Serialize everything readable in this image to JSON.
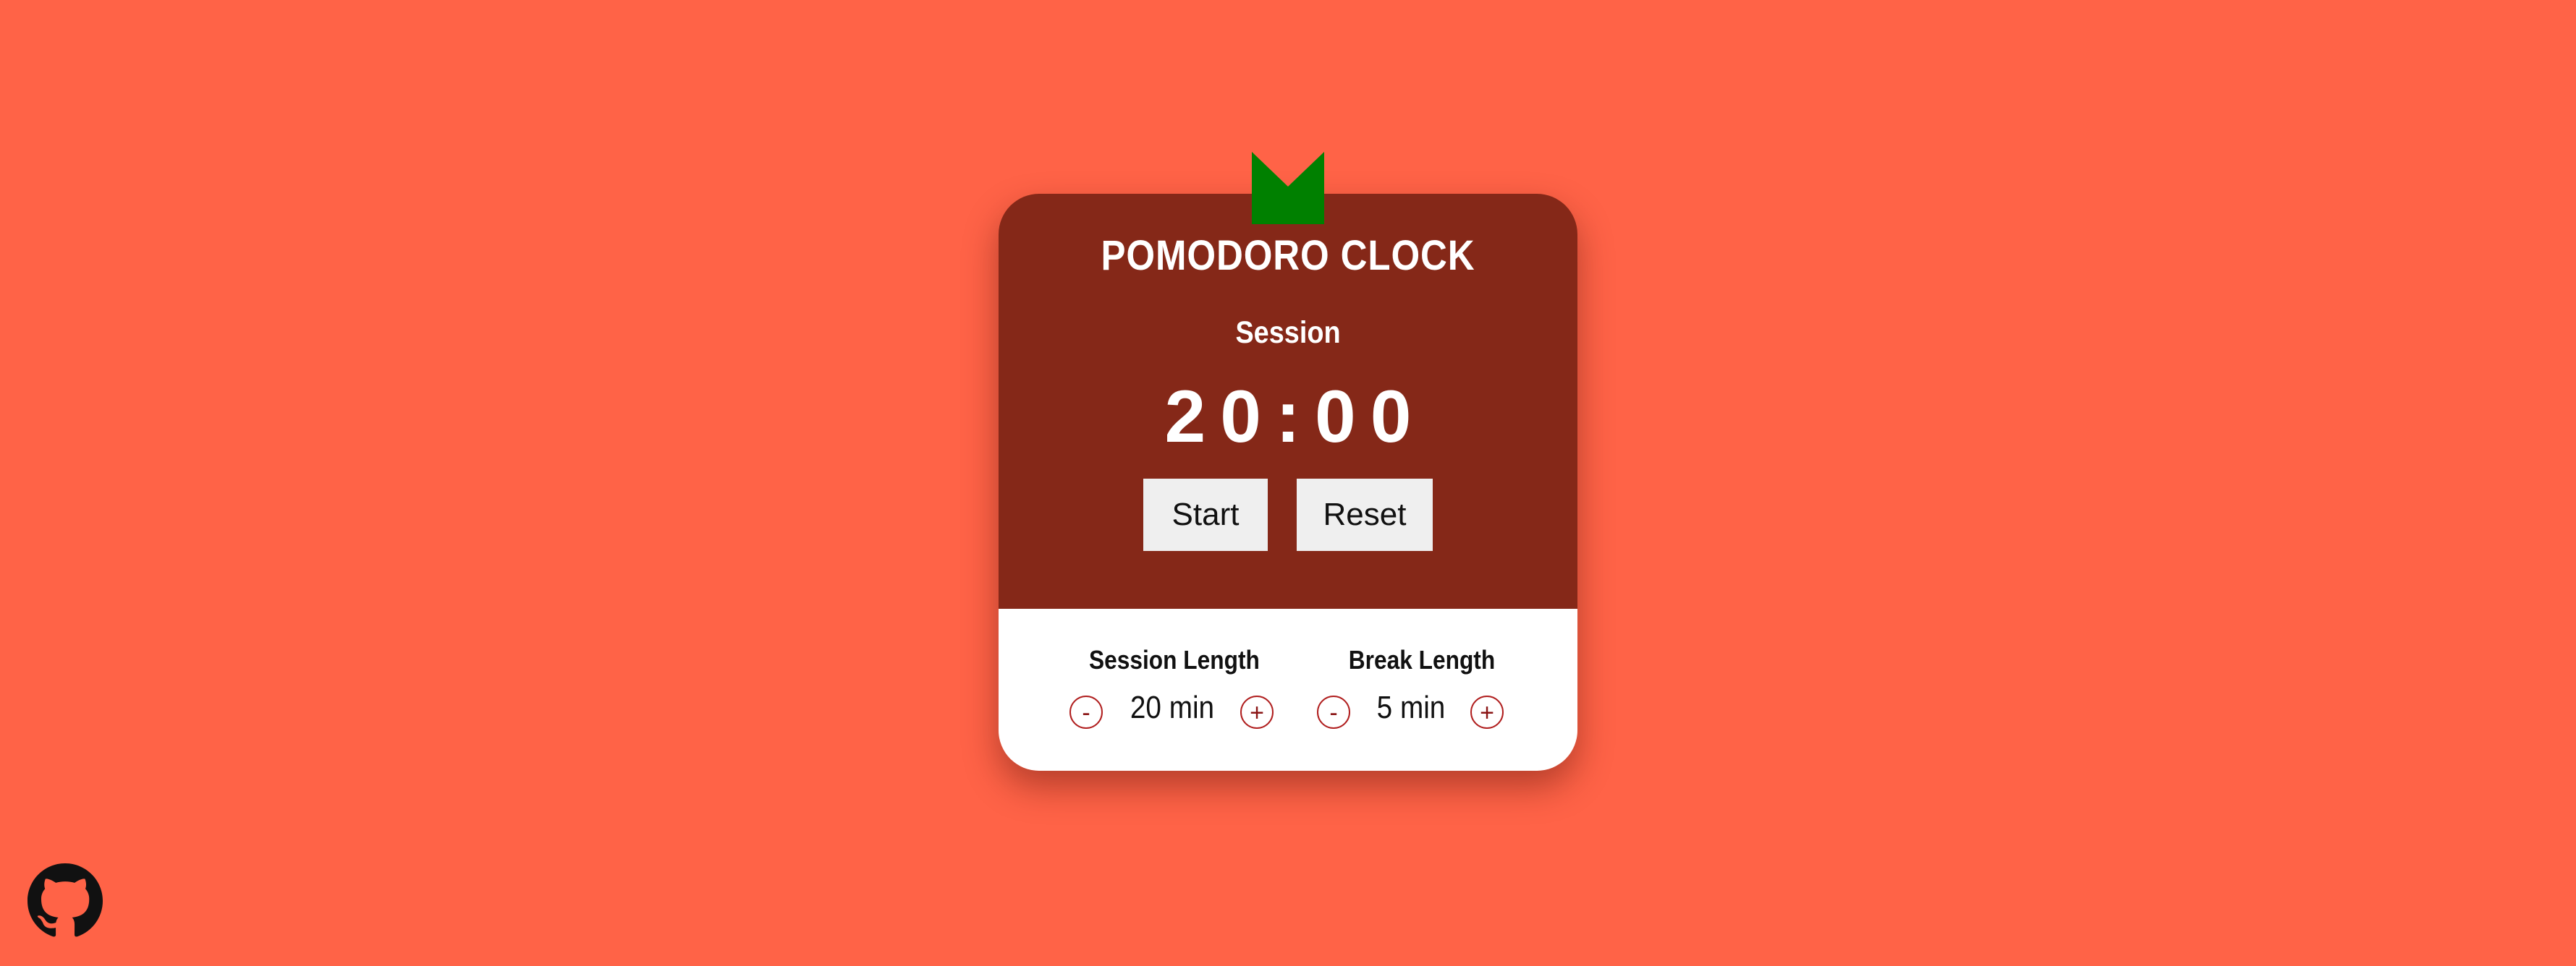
{
  "colors": {
    "background": "#ff6347",
    "card_top": "#852818",
    "card_bottom": "#ffffff",
    "leaf": "#008000",
    "button_bg": "#efefef",
    "stepper_border": "#b01e1e"
  },
  "header": {
    "title": "POMODORO CLOCK"
  },
  "timer": {
    "mode": "Session",
    "display": "20:00"
  },
  "controls": {
    "start_label": "Start",
    "reset_label": "Reset"
  },
  "settings": {
    "session": {
      "label": "Session Length",
      "value": "20 min",
      "minus": "-",
      "plus": "+"
    },
    "break": {
      "label": "Break Length",
      "value": "5 min",
      "minus": "-",
      "plus": "+"
    }
  },
  "icons": {
    "leaf": "tomato-leaf-icon",
    "github": "github-icon"
  }
}
